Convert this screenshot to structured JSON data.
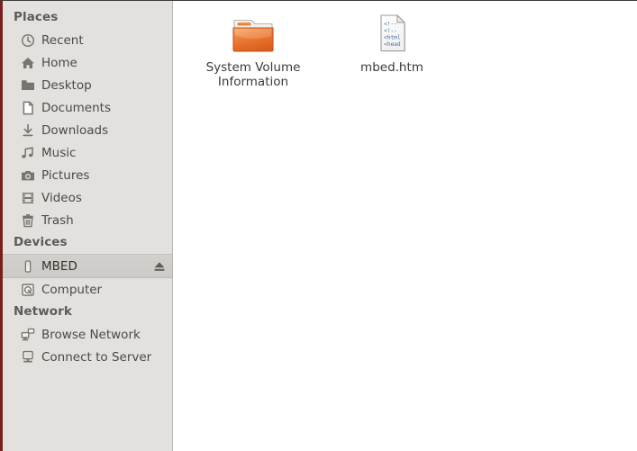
{
  "sidebar": {
    "sections": [
      {
        "name": "places",
        "title": "Places",
        "items": [
          {
            "label": "Recent",
            "icon": "clock-icon"
          },
          {
            "label": "Home",
            "icon": "home-icon"
          },
          {
            "label": "Desktop",
            "icon": "folder-icon"
          },
          {
            "label": "Documents",
            "icon": "document-icon"
          },
          {
            "label": "Downloads",
            "icon": "download-icon"
          },
          {
            "label": "Music",
            "icon": "music-note-icon"
          },
          {
            "label": "Pictures",
            "icon": "camera-icon"
          },
          {
            "label": "Videos",
            "icon": "film-icon"
          },
          {
            "label": "Trash",
            "icon": "trash-icon"
          }
        ]
      },
      {
        "name": "devices",
        "title": "Devices",
        "items": [
          {
            "label": "MBED",
            "icon": "usb-drive-icon",
            "selected": true,
            "eject": true,
            "eject_icon": "eject-icon"
          },
          {
            "label": "Computer",
            "icon": "computer-disk-icon"
          }
        ]
      },
      {
        "name": "network",
        "title": "Network",
        "items": [
          {
            "label": "Browse Network",
            "icon": "network-browse-icon"
          },
          {
            "label": "Connect to Server",
            "icon": "server-connect-icon"
          }
        ]
      }
    ]
  },
  "content": {
    "files": [
      {
        "label": "System Volume Information",
        "type": "folder",
        "icon": "folder-icon"
      },
      {
        "label": "mbed.htm",
        "type": "html-file",
        "icon": "html-document-icon",
        "preview_lines": [
          "<!--",
          "<!--",
          "<html",
          "<head"
        ]
      }
    ]
  },
  "colors": {
    "sidebar_bg": "#e3e1de",
    "sidebar_edge": "#7a1d1d",
    "selection_bg": "#d0cecA",
    "folder_orange": "#e8702a",
    "text": "#4a4945",
    "header_text": "#5c5b57"
  }
}
